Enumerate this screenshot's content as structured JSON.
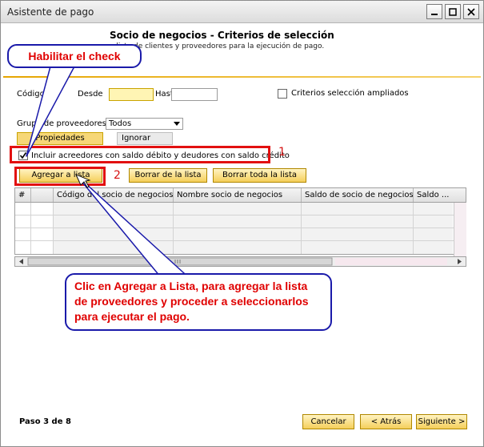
{
  "window": {
    "title": "Asistente de pago"
  },
  "header": {
    "title": "Socio de negocios - Criterios de selección",
    "subtitle": "e lista de clientes y proveedores para la ejecución de pago."
  },
  "form": {
    "codigo_label": "Código",
    "desde_label": "Desde",
    "hasta_label": "Hast",
    "desde_value": "",
    "hasta_value": "",
    "criterios_label": "Criterios selección ampliados",
    "grupo_label": "Grupo de proveedores",
    "grupo_value": "Todos",
    "propiedades_label": "Propiedades",
    "ignorar_label": "Ignorar",
    "incluir_label": "Incluir acreedores con saldo débito y deudores con saldo crédito"
  },
  "buttons": {
    "agregar": "Agregar a lista",
    "borrar": "Borrar de la lista",
    "borrar_toda": "Borrar toda la lista"
  },
  "grid": {
    "columns": [
      "#",
      "",
      "Código del socio de negocios",
      "Nombre socio de negocios",
      "Saldo de socio de negocios...",
      "Saldo ..."
    ]
  },
  "annotations": {
    "num1": "1",
    "num2": "2",
    "callout_check": "Habilitar el check",
    "callout_agregar": "Clic en Agregar a Lista, para agregar la lista de proveedores y proceder a seleccionarlos para ejecutar el pago."
  },
  "footer": {
    "step": "Paso 3 de 8",
    "cancel": "Cancelar",
    "back": "< Atrás",
    "next": "Siguiente >"
  },
  "colors": {
    "accent_yellow": "#f5cf5a",
    "annotation_red": "#e21010",
    "callout_blue": "#1a1aaa"
  }
}
